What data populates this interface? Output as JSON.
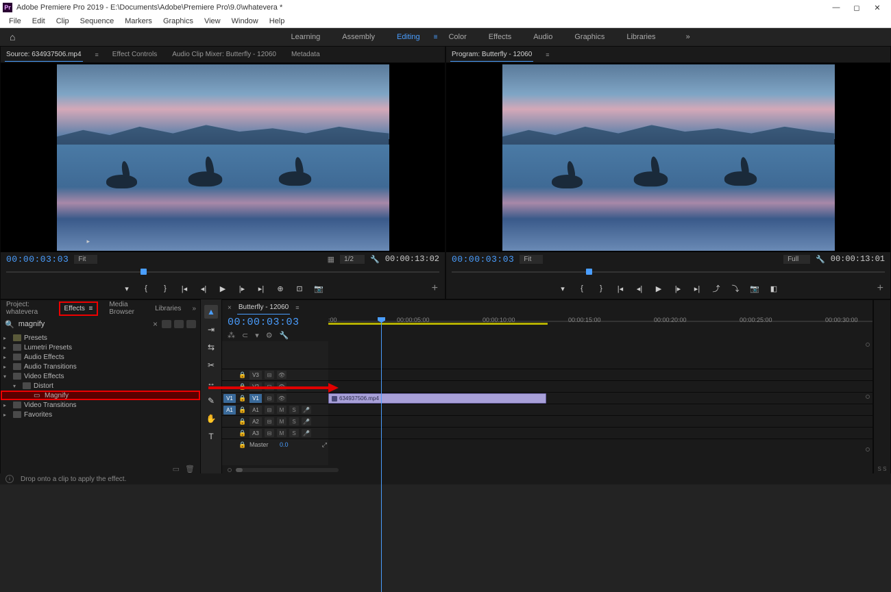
{
  "app": {
    "title": "Adobe Premiere Pro 2019 - E:\\Documents\\Adobe\\Premiere Pro\\9.0\\whatevera *"
  },
  "menu": [
    "File",
    "Edit",
    "Clip",
    "Sequence",
    "Markers",
    "Graphics",
    "View",
    "Window",
    "Help"
  ],
  "workspaces": {
    "items": [
      "Learning",
      "Assembly",
      "Editing",
      "Color",
      "Effects",
      "Audio",
      "Graphics",
      "Libraries"
    ],
    "active": "Editing"
  },
  "source": {
    "tabs": [
      "Source: 634937506.mp4",
      "Effect Controls",
      "Audio Clip Mixer: Butterfly - 12060",
      "Metadata"
    ],
    "tc_in": "00:00:03:03",
    "fit": "Fit",
    "zoom": "1/2",
    "tc_out": "00:00:13:02"
  },
  "program": {
    "tab": "Program: Butterfly - 12060",
    "tc_in": "00:00:03:03",
    "fit": "Fit",
    "zoom": "Full",
    "tc_out": "00:00:13:01"
  },
  "effects": {
    "tabs": {
      "project": "Project: whatevera",
      "effects": "Effects",
      "media": "Media Browser",
      "libraries": "Libraries"
    },
    "search": "magnify",
    "tree": {
      "presets": "Presets",
      "lumetri": "Lumetri Presets",
      "audiofx": "Audio Effects",
      "audiotr": "Audio Transitions",
      "videofx": "Video Effects",
      "distort": "Distort",
      "magnify": "Magnify",
      "videotr": "Video Transitions",
      "fav": "Favorites"
    }
  },
  "timeline": {
    "tab": "Butterfly - 12060",
    "tc": "00:00:03:03",
    "ruler": [
      ":00",
      "00:00:05:00",
      "00:00:10:00",
      "00:00:15:00",
      "00:00:20:00",
      "00:00:25:00",
      "00:00:30:00"
    ],
    "tracks": {
      "v3": "V3",
      "v2": "V2",
      "v1": "V1",
      "a1": "A1",
      "a2": "A2",
      "a3": "A3",
      "master": "Master",
      "master_val": "0.0",
      "src_v1": "V1",
      "src_a1": "A1"
    },
    "clip": "634937506.mp4"
  },
  "status": {
    "hint": "Drop onto a clip to apply the effect."
  },
  "toggles": {
    "m": "M",
    "s": "S"
  }
}
